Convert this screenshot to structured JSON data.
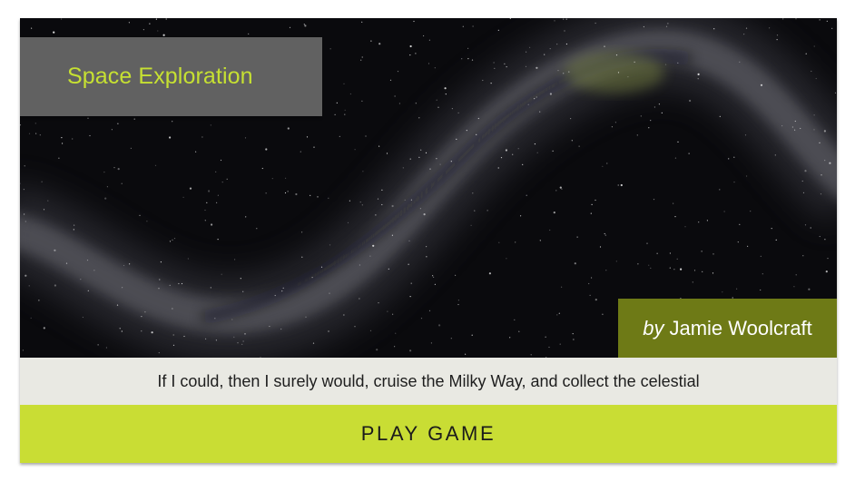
{
  "card": {
    "title": "Space Exploration",
    "author_prefix": "by",
    "author_name": "Jamie Woolcraft",
    "description": "If I could, then I surely would, cruise the Milky Way, and collect the celestial",
    "play_label": "PLAY GAME"
  },
  "hero_image": {
    "subject": "milky-way-galaxy-band"
  },
  "colors": {
    "accent": "#c9dd34",
    "title_text": "#c6e032",
    "title_box": "#616161",
    "author_box": "#6e7a16",
    "description_bg": "#e9e9e3",
    "space_bg": "#0a0a0d"
  }
}
